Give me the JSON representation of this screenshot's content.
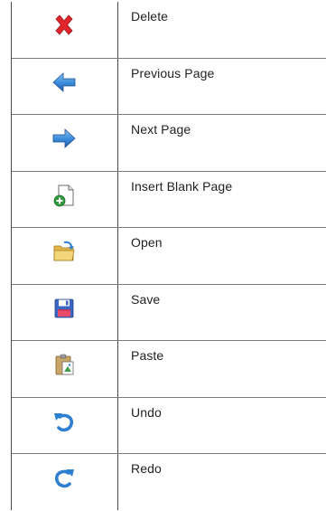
{
  "rows": [
    {
      "icon": "arrow-left-icon",
      "label": "Previous Page"
    },
    {
      "icon": "arrow-right-icon",
      "label": "Next Page"
    },
    {
      "icon": "blank-page-icon",
      "label": "Insert Blank Page"
    },
    {
      "icon": "folder-open-icon",
      "label": "Open"
    },
    {
      "icon": "floppy-disk-icon",
      "label": "Save"
    },
    {
      "icon": "clipboard-icon",
      "label": "Paste"
    },
    {
      "icon": "undo-icon",
      "label": "Undo"
    },
    {
      "icon": "redo-icon",
      "label": "Redo"
    },
    {
      "icon": "delete-x-icon",
      "label": "Delete"
    }
  ]
}
